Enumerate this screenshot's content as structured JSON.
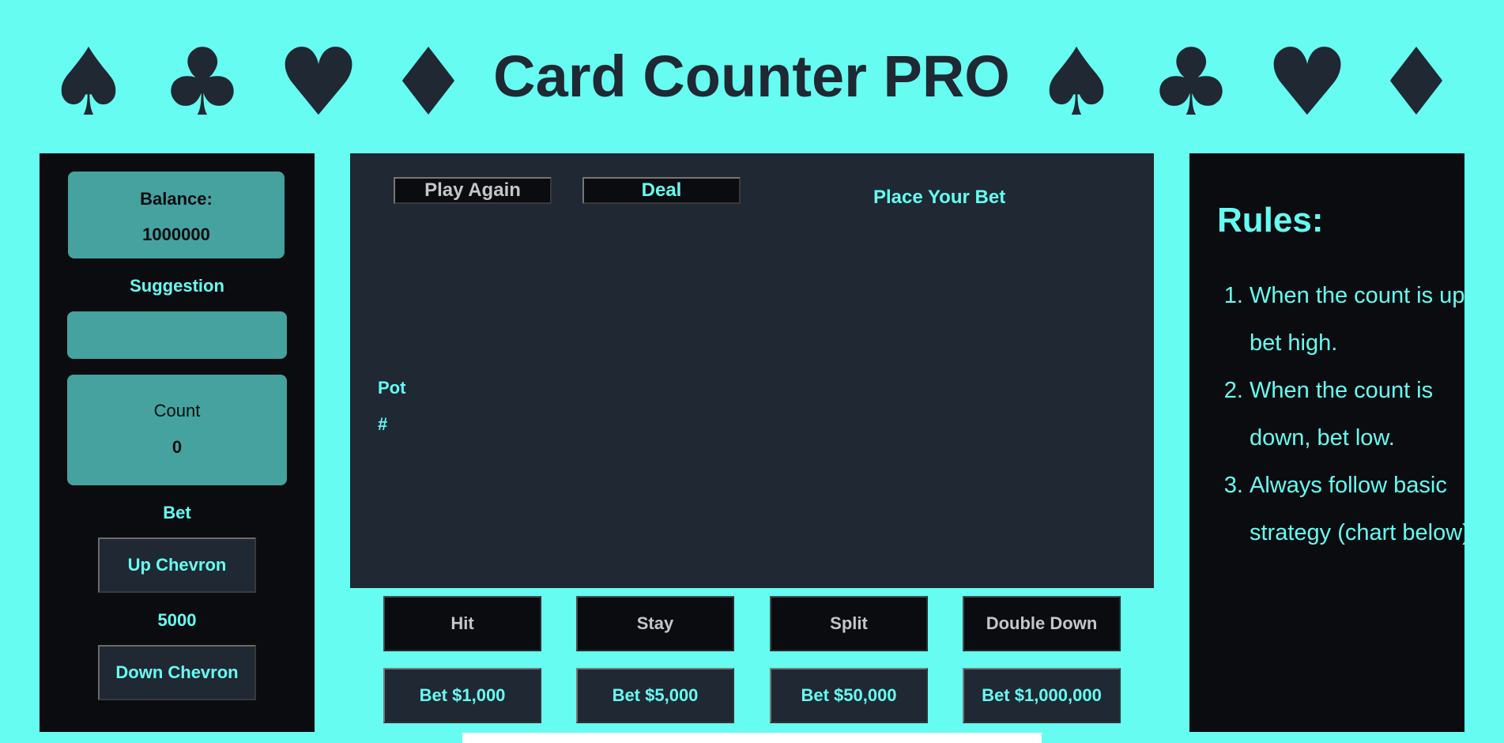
{
  "header": {
    "title": "Card Counter PRO",
    "suits_left": [
      "♠",
      "♣",
      "♥",
      "♦"
    ],
    "suits_right": [
      "♠",
      "♣",
      "♥",
      "♦"
    ]
  },
  "left_panel": {
    "balance_label": "Balance:",
    "balance_value": "1000000",
    "suggestion_label": "Suggestion",
    "suggestion_value": "",
    "count_label": "Count",
    "count_value": "0",
    "bet_label": "Bet",
    "up_chevron_label": "Up Chevron",
    "bet_value": "5000",
    "down_chevron_label": "Down Chevron"
  },
  "table": {
    "play_again_label": "Play Again",
    "deal_label": "Deal",
    "status_text": "Place Your Bet",
    "pot_label": "Pot",
    "pot_value": "#"
  },
  "actions": {
    "hit": "Hit",
    "stay": "Stay",
    "split": "Split",
    "double_down": "Double Down"
  },
  "bets": {
    "bet_1000": "Bet $1,000",
    "bet_5000": "Bet $5,000",
    "bet_50000": "Bet $50,000",
    "bet_1000000": "Bet $1,000,000"
  },
  "rules": {
    "title": "Rules:",
    "items": [
      "When the count is up, bet high.",
      "When the count is down, bet low.",
      "Always follow basic strategy (chart below)."
    ]
  },
  "colors": {
    "background": "#66fcf1",
    "panel_dark": "#0b0c10",
    "table": "#1f2833",
    "teal_box": "#45a29e",
    "accent_text": "#66fcf1",
    "muted_text": "#c5c6c7"
  }
}
